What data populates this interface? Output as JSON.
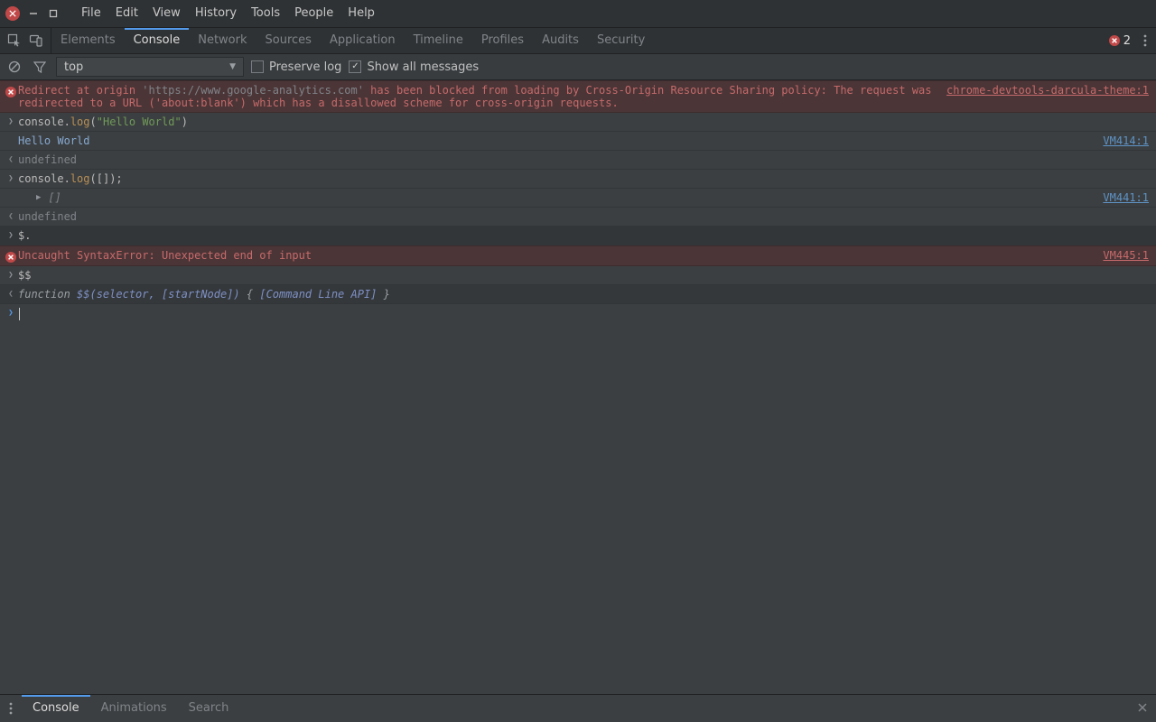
{
  "menu": {
    "items": [
      "File",
      "Edit",
      "View",
      "History",
      "Tools",
      "People",
      "Help"
    ]
  },
  "devtools_tabs": {
    "items": [
      "Elements",
      "Console",
      "Network",
      "Sources",
      "Application",
      "Timeline",
      "Profiles",
      "Audits",
      "Security"
    ],
    "active_index": 1,
    "error_badge": {
      "count": "2"
    }
  },
  "console_toolbar": {
    "context_label": "top",
    "preserve_log": {
      "label": "Preserve log",
      "checked": false
    },
    "show_all": {
      "label": "Show all messages",
      "checked": true
    }
  },
  "drawer": {
    "tabs": [
      "Console",
      "Animations",
      "Search"
    ],
    "active_index": 0
  },
  "rows": {
    "err1": {
      "pre": "Redirect at origin ",
      "origin": "'https://www.google-analytics.com'",
      "post": " has been blocked from loading by Cross-Origin Resource Sharing policy: The request was redirected to a URL ('about:blank') which has a disallowed scheme for cross-origin requests.",
      "source": "chrome-devtools-darcula-theme:1"
    },
    "input1": {
      "obj": "console",
      "dot": ".",
      "method": "log",
      "open": "(",
      "str_q": "\"",
      "str_body": "Hello World",
      "close": ")"
    },
    "log1": {
      "text": "Hello World",
      "source": "VM414:1"
    },
    "ret1": {
      "text": "undefined"
    },
    "input2": {
      "obj": "console",
      "dot": ".",
      "method": "log",
      "open": "(",
      "body": "[]",
      "close": ");"
    },
    "log2": {
      "arr_text": "[]",
      "source": "VM441:1"
    },
    "ret2": {
      "text": "undefined"
    },
    "input3": {
      "text": "$."
    },
    "err2": {
      "text": "Uncaught SyntaxError: Unexpected end of input",
      "source": "VM445:1"
    },
    "input4": {
      "text": "$$"
    },
    "func": {
      "kw": "function ",
      "sig": "$$(selector, [startNode])",
      "brace_open": " { ",
      "body": "[Command Line API]",
      "brace_close": " }"
    }
  }
}
